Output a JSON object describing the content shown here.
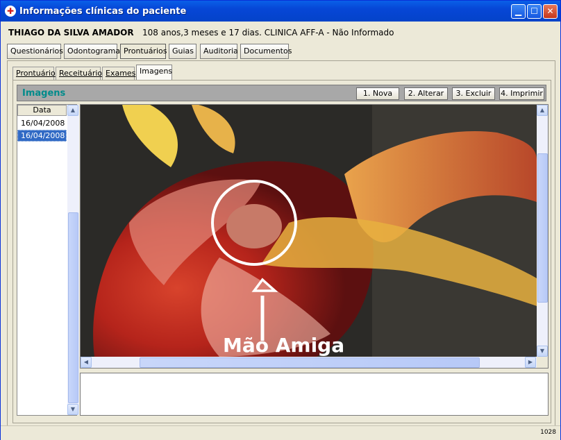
{
  "window": {
    "title": "Informações clínicas do paciente",
    "icon": "medical-app-icon",
    "controls": [
      "minimize-icon",
      "maximize-icon",
      "close-icon"
    ]
  },
  "patient": {
    "name": "THIAGO DA SILVA AMADOR",
    "info": "108 anos,3 meses e 17 dias.  CLINICA  AFF-A   - Não Informado"
  },
  "main_tabs": [
    "Questionários",
    "Odontograma",
    "Prontuários",
    "Guias",
    "Auditoria",
    "Documentos"
  ],
  "active_main_tab": "Prontuários",
  "sub_tabs": [
    "Prontuário",
    "Receituário",
    "Exames",
    "Imagens"
  ],
  "active_sub_tab": "Imagens",
  "images_panel": {
    "title": "Imagens",
    "buttons": [
      "1. Nova",
      "2. Alterar",
      "3. Excluir",
      "4. Imprimir"
    ]
  },
  "list": {
    "header": "Data",
    "items": [
      "16/04/2008",
      "16/04/2008"
    ],
    "selected_index": 1
  },
  "image": {
    "caption": "Mão Amiga",
    "description_icon": "photo-surgery-hand"
  },
  "status": {
    "code": "1028"
  },
  "colors": {
    "title_bar": "#0a5fe8",
    "panel_title": "#008b8b",
    "selection": "#316ac5"
  }
}
